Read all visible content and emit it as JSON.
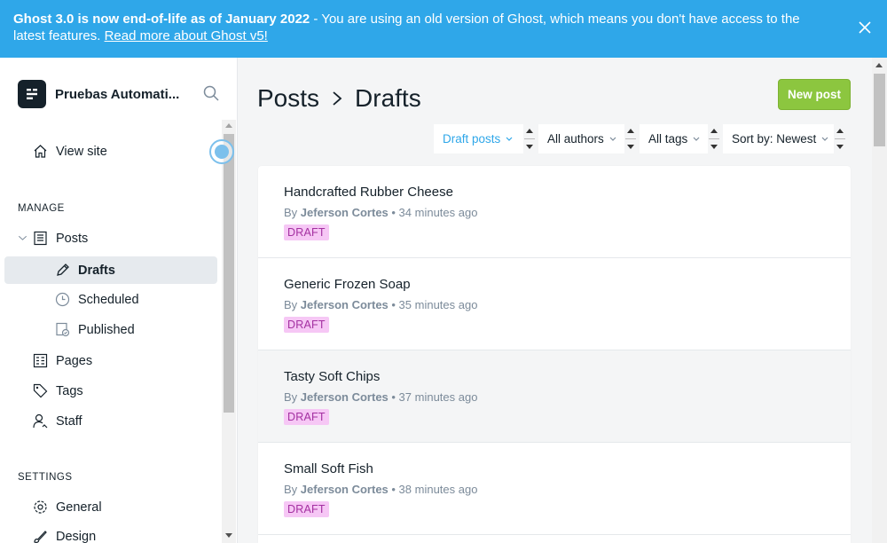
{
  "banner": {
    "bold": "Ghost 3.0 is now end-of-life as of January 2022",
    "text": " - You are using an old version of Ghost, which means you don't have access to the latest features. ",
    "link": "Read more about Ghost v5!"
  },
  "sidebar": {
    "site_name": "Pruebas Automati...",
    "view_site": "View site",
    "manage_label": "MANAGE",
    "posts": "Posts",
    "drafts": "Drafts",
    "scheduled": "Scheduled",
    "published": "Published",
    "pages": "Pages",
    "tags": "Tags",
    "staff": "Staff",
    "settings_label": "SETTINGS",
    "general": "General",
    "design": "Design"
  },
  "header": {
    "crumb_root": "Posts",
    "crumb_current": "Drafts",
    "new_post": "New post"
  },
  "filters": {
    "type": "Draft posts",
    "author": "All authors",
    "tag": "All tags",
    "sort": "Sort by: Newest"
  },
  "posts": [
    {
      "title": "Handcrafted Rubber Cheese",
      "by": "By ",
      "author": "Jeferson Cortes",
      "time": " • 34 minutes ago",
      "status": "DRAFT"
    },
    {
      "title": "Generic Frozen Soap",
      "by": "By ",
      "author": "Jeferson Cortes",
      "time": " • 35 minutes ago",
      "status": "DRAFT"
    },
    {
      "title": "Tasty Soft Chips",
      "by": "By ",
      "author": "Jeferson Cortes",
      "time": " • 37 minutes ago",
      "status": "DRAFT"
    },
    {
      "title": "Small Soft Fish",
      "by": "By ",
      "author": "Jeferson Cortes",
      "time": " • 38 minutes ago",
      "status": "DRAFT"
    }
  ],
  "colors": {
    "banner": "#2fa7e9",
    "accent": "#8cc63f",
    "filter_active": "#2fa7e9",
    "draft_badge_bg": "#f6c7f5",
    "draft_badge_text": "#a430a1"
  }
}
